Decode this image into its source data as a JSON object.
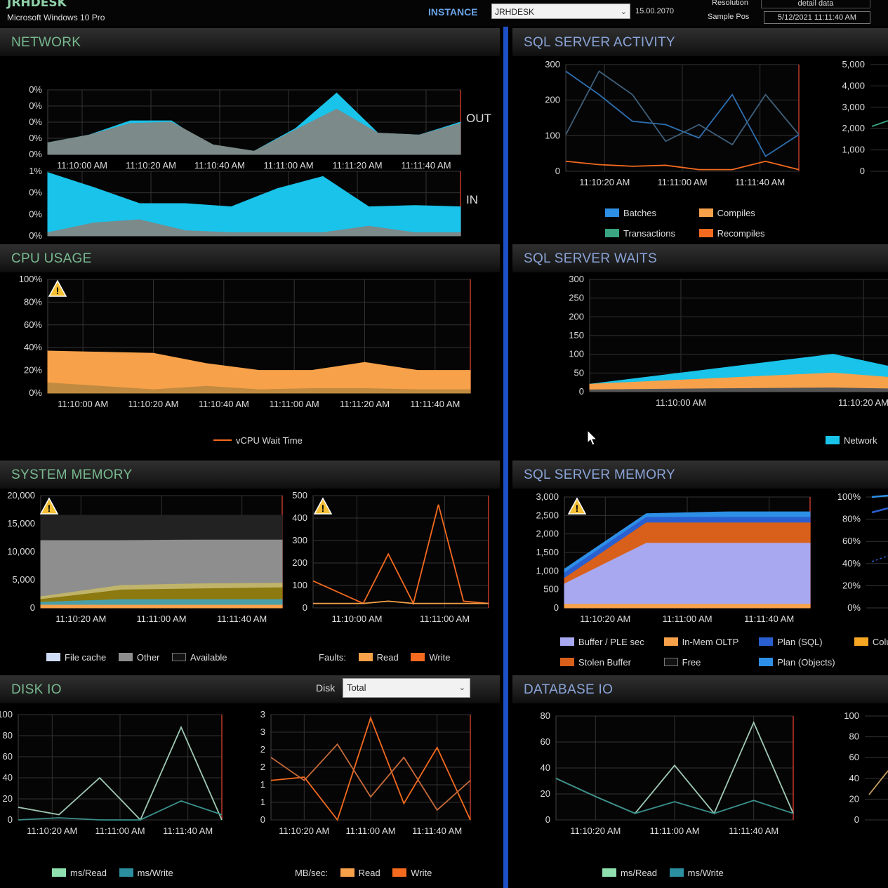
{
  "header": {
    "host": "JRHDESK",
    "os": "Microsoft Windows 10 Pro",
    "instance_label": "INSTANCE",
    "instance_value": "JRHDESK",
    "version": "15.00.2070",
    "resolution_label": "Resolution",
    "resolution_value": "detail data",
    "sample_label": "Sample Pos",
    "sample_value": "5/12/2021 11:11:40 AM"
  },
  "panels": {
    "network": "NETWORK",
    "cpu": "CPU USAGE",
    "sysmem": "SYSTEM MEMORY",
    "diskio": "DISK IO",
    "sqlact": "SQL SERVER ACTIVITY",
    "waits": "SQL SERVER WAITS",
    "sqlmem": "SQL SERVER MEMORY",
    "dbio": "DATABASE IO"
  },
  "disk": {
    "label": "Disk",
    "value": "Total"
  },
  "legends": {
    "sqlact": [
      "Batches",
      "Compiles",
      "Transactions",
      "Recompiles"
    ],
    "cpu": "vCPU Wait Time",
    "waits": "Network",
    "sysmem": [
      "File cache",
      "Other",
      "Available"
    ],
    "faults": [
      "Faults:",
      "Read",
      "Write"
    ],
    "sqlmem": [
      "Buffer / PLE sec",
      "In-Mem OLTP",
      "Plan (SQL)",
      "Colu",
      "Stolen Buffer",
      "Free",
      "Plan (Objects)"
    ],
    "disk1": [
      "ms/Read",
      "ms/Write"
    ],
    "disk2": [
      "MB/sec:",
      "Read",
      "Write"
    ],
    "dbio": [
      "ms/Read",
      "ms/Write"
    ]
  },
  "colors": {
    "cyan": "#19c3ea",
    "gray": "#7c8a8a",
    "orange": "#f7a14a",
    "deep_orange": "#f46a1f",
    "blue": "#2d8fe6",
    "teal": "#3aa580",
    "lavender": "#a8a8f0",
    "mint": "#8fe0ae"
  },
  "chart_data": [
    {
      "name": "network-out",
      "type": "area",
      "x": [
        "11:10:00 AM",
        "11:10:10 AM",
        "11:10:20 AM",
        "11:10:30 AM",
        "11:10:40 AM",
        "11:10:50 AM",
        "11:11:00 AM",
        "11:11:10 AM",
        "11:11:20 AM",
        "11:11:30 AM",
        "11:11:40 AM"
      ],
      "xticks": [
        "11:10:00 AM",
        "11:10:20 AM",
        "11:10:40 AM",
        "11:11:00 AM",
        "11:11:20 AM",
        "11:11:40 AM"
      ],
      "yticks": [
        "0%",
        "0%",
        "0%",
        "0%",
        "0%"
      ],
      "label": "OUT",
      "series": [
        {
          "values": [
            0.18,
            0.3,
            0.52,
            0.52,
            0.1,
            0.05,
            0.4,
            0.95,
            0.33,
            0.3,
            0.5
          ],
          "color": "#19c3ea"
        },
        {
          "values": [
            0.18,
            0.3,
            0.48,
            0.5,
            0.15,
            0.05,
            0.38,
            0.7,
            0.33,
            0.3,
            0.48
          ],
          "color": "#7c8a8a"
        }
      ],
      "ylim": [
        0,
        1
      ]
    },
    {
      "name": "network-in",
      "type": "area",
      "xticks": [
        "11:10:00 AM",
        "11:10:20 AM",
        "11:10:40 AM",
        "11:11:00 AM",
        "11:11:20 AM",
        "11:11:40 AM"
      ],
      "yticks": [
        "1%",
        "0%",
        "0%",
        "0%"
      ],
      "label": "IN",
      "series": [
        {
          "values": [
            0.98,
            0.75,
            0.5,
            0.5,
            0.45,
            0.73,
            0.92,
            0.45,
            0.47,
            0.45
          ],
          "color": "#19c3ea"
        },
        {
          "values": [
            0.05,
            0.2,
            0.25,
            0.08,
            0.05,
            0.05,
            0.05,
            0.15,
            0.05,
            0.05
          ],
          "color": "#7c8a8a"
        }
      ],
      "ylim": [
        0,
        1
      ]
    },
    {
      "name": "cpu-usage",
      "type": "area",
      "xticks": [
        "11:10:00 AM",
        "11:10:20 AM",
        "11:10:40 AM",
        "11:11:00 AM",
        "11:11:20 AM",
        "11:11:40 AM"
      ],
      "yticks": [
        "100%",
        "80%",
        "60%",
        "40%",
        "20%",
        "0%"
      ],
      "series": [
        {
          "values": [
            37,
            36,
            35,
            26,
            20,
            20,
            27,
            20,
            20
          ],
          "color": "#f7a14a"
        },
        {
          "values": [
            9,
            6,
            3,
            6,
            3,
            4,
            4,
            3,
            3
          ],
          "color": "#c08a40"
        }
      ],
      "ylim": [
        0,
        100
      ]
    },
    {
      "name": "system-memory",
      "type": "area",
      "xticks": [
        "11:10:20 AM",
        "11:11:00 AM",
        "11:11:40 AM"
      ],
      "yticks": [
        "20,000",
        "15,000",
        "10,000",
        "5,000",
        "0"
      ],
      "series": [
        {
          "values": [
            16500,
            16500,
            16500,
            16500
          ],
          "color": "#222222",
          "name": "Available"
        },
        {
          "values": [
            12000,
            12000,
            12100,
            12100
          ],
          "color": "#8e8e8e",
          "name": "Other"
        },
        {
          "values": [
            2000,
            4000,
            4300,
            4400
          ],
          "color": "#c0b46a"
        },
        {
          "values": [
            1500,
            3200,
            3400,
            3600
          ],
          "color": "#8c7a10"
        },
        {
          "values": [
            1000,
            1500,
            1500,
            1500
          ],
          "color": "#4a9ea8",
          "name": "File cache"
        },
        {
          "values": [
            500,
            500,
            500,
            500
          ],
          "color": "#f7a14a"
        }
      ],
      "ylim": [
        0,
        20000
      ]
    },
    {
      "name": "memory-faults",
      "type": "line",
      "xticks": [
        "11:10:00 AM",
        "11:11:00 AM"
      ],
      "yticks": [
        "500",
        "400",
        "300",
        "200",
        "100",
        "0"
      ],
      "series": [
        {
          "values": [
            120,
            70,
            20,
            240,
            20,
            460,
            30,
            20
          ],
          "color": "#f46a1f",
          "name": "Write"
        },
        {
          "values": [
            20,
            20,
            20,
            30,
            20,
            20,
            20,
            20
          ],
          "color": "#f7a14a",
          "name": "Read"
        }
      ],
      "ylim": [
        0,
        500
      ]
    },
    {
      "name": "disk-latency",
      "type": "line",
      "xticks": [
        "11:10:20 AM",
        "11:11:00 AM",
        "11:11:40 AM"
      ],
      "yticks": [
        "100",
        "80",
        "60",
        "40",
        "20",
        "0"
      ],
      "series": [
        {
          "values": [
            12,
            5,
            40,
            0,
            88,
            0
          ],
          "color": "#9fc9b4",
          "name": "ms/Read"
        },
        {
          "values": [
            0,
            2,
            0,
            0,
            18,
            5
          ],
          "color": "#3a8f8a",
          "name": "ms/Write"
        }
      ],
      "ylim": [
        0,
        100
      ]
    },
    {
      "name": "disk-throughput",
      "type": "line",
      "xticks": [
        "11:10:20 AM",
        "11:11:00 AM",
        "11:11:40 AM"
      ],
      "yticks": [
        "3",
        "3",
        "2",
        "2",
        "1",
        "1",
        "0"
      ],
      "series": [
        {
          "values": [
            1.2,
            1.3,
            0,
            3.1,
            0.5,
            2.2,
            0
          ],
          "color": "#f46a1f",
          "name": "Write"
        },
        {
          "values": [
            1.9,
            1.2,
            2.3,
            0.7,
            1.9,
            0.3,
            1.2
          ],
          "color": "#c86a3a",
          "name": "Read"
        }
      ],
      "ylim": [
        0,
        3.2
      ]
    },
    {
      "name": "sql-activity",
      "type": "line",
      "xticks": [
        "11:10:20 AM",
        "11:11:00 AM",
        "11:11:40 AM"
      ],
      "yticks_left": [
        "300",
        "200",
        "100",
        "0"
      ],
      "yticks_right": [
        "5,000",
        "4,000",
        "3,000",
        "2,000",
        "1,000",
        "0"
      ],
      "series": [
        {
          "values": [
            300,
            230,
            150,
            140,
            100,
            230,
            45,
            110
          ],
          "color": "#2d6fb0",
          "name": "Batches"
        },
        {
          "values": [
            110,
            300,
            230,
            90,
            140,
            80,
            230,
            110
          ],
          "color": "#3f5f7a"
        },
        {
          "values": [
            30,
            20,
            15,
            18,
            5,
            5,
            30,
            5
          ],
          "color": "#f46a1f",
          "name": "Recompiles"
        }
      ],
      "ylim": [
        0,
        320
      ]
    },
    {
      "name": "sql-waits",
      "type": "area",
      "xticks": [
        "11:10:00 AM",
        "11:10:20 AM"
      ],
      "yticks": [
        "300",
        "250",
        "200",
        "150",
        "100",
        "50",
        "0"
      ],
      "series": [
        {
          "values": [
            20,
            60,
            100,
            30
          ],
          "color": "#19c3ea",
          "name": "Network"
        },
        {
          "values": [
            20,
            35,
            50,
            25
          ],
          "color": "#f7a14a"
        },
        {
          "values": [
            5,
            8,
            10,
            5
          ],
          "color": "#555555"
        }
      ],
      "ylim": [
        0,
        300
      ]
    },
    {
      "name": "sql-server-memory",
      "type": "area",
      "xticks": [
        "11:10:20 AM",
        "11:11:00 AM",
        "11:11:40 AM"
      ],
      "yticks": [
        "3,000",
        "2,500",
        "2,000",
        "1,500",
        "1,000",
        "500",
        "0"
      ],
      "yticks_right": [
        "100%",
        "80%",
        "60%",
        "40%",
        "20%",
        "0%"
      ],
      "series": [
        {
          "values": [
            1050,
            2550,
            2600,
            2600
          ],
          "color": "#2d8fe6",
          "name": "Plan (Objects)"
        },
        {
          "values": [
            950,
            2450,
            2450,
            2450
          ],
          "color": "#2a5fd0",
          "name": "Plan (SQL)"
        },
        {
          "values": [
            800,
            2300,
            2300,
            2300
          ],
          "color": "#d8601a",
          "name": "Stolen Buffer"
        },
        {
          "values": [
            650,
            1750,
            1750,
            1750
          ],
          "color": "#a8a8f0",
          "name": "Buffer / PLE sec"
        },
        {
          "values": [
            100,
            100,
            100,
            100
          ],
          "color": "#f7a14a",
          "name": "Colu"
        }
      ],
      "ylim": [
        0,
        3000
      ]
    },
    {
      "name": "database-io",
      "type": "line",
      "xticks": [
        "11:10:20 AM",
        "11:11:00 AM",
        "11:11:40 AM"
      ],
      "yticks": [
        "80",
        "60",
        "40",
        "20",
        "0"
      ],
      "yticks_right": [
        "100",
        "80",
        "60",
        "40",
        "20",
        "0"
      ],
      "series": [
        {
          "values": [
            32,
            18,
            5,
            42,
            5,
            75,
            5
          ],
          "color": "#9fc9b4",
          "name": "ms/Read"
        },
        {
          "values": [
            32,
            18,
            5,
            14,
            5,
            15,
            5
          ],
          "color": "#3a8f8a",
          "name": "ms/Write"
        }
      ],
      "ylim": [
        0,
        80
      ]
    }
  ]
}
